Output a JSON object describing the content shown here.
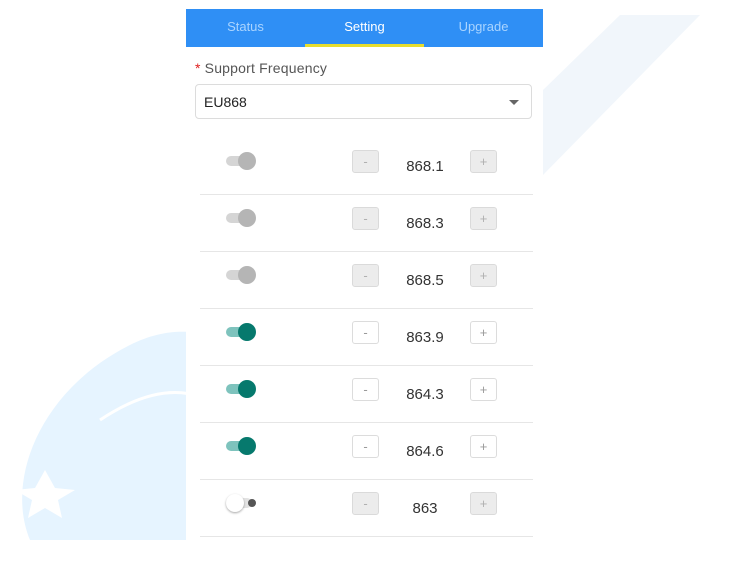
{
  "tabs": [
    {
      "label": "Status",
      "active": false
    },
    {
      "label": "Setting",
      "active": true
    },
    {
      "label": "Upgrade",
      "active": false
    }
  ],
  "form": {
    "required_mark": "*",
    "label": "Support Frequency",
    "selected_value": "EU868"
  },
  "channels": [
    {
      "enabled": true,
      "locked": true,
      "frequency": "868.1",
      "minus_label": "-",
      "plus_label": "+"
    },
    {
      "enabled": true,
      "locked": true,
      "frequency": "868.3",
      "minus_label": "-",
      "plus_label": "+"
    },
    {
      "enabled": true,
      "locked": true,
      "frequency": "868.5",
      "minus_label": "-",
      "plus_label": "+"
    },
    {
      "enabled": true,
      "locked": false,
      "frequency": "863.9",
      "minus_label": "-",
      "plus_label": "+"
    },
    {
      "enabled": true,
      "locked": false,
      "frequency": "864.3",
      "minus_label": "-",
      "plus_label": "+"
    },
    {
      "enabled": true,
      "locked": false,
      "frequency": "864.6",
      "minus_label": "-",
      "plus_label": "+"
    },
    {
      "enabled": false,
      "locked": false,
      "frequency": "863",
      "minus_label": "-",
      "plus_label": "+"
    }
  ],
  "colors": {
    "tab_bar": "#2f8ff5",
    "tab_indicator": "#e7dd2d",
    "toggle_on": "#06796d",
    "watermark": "#e6f4ff"
  }
}
